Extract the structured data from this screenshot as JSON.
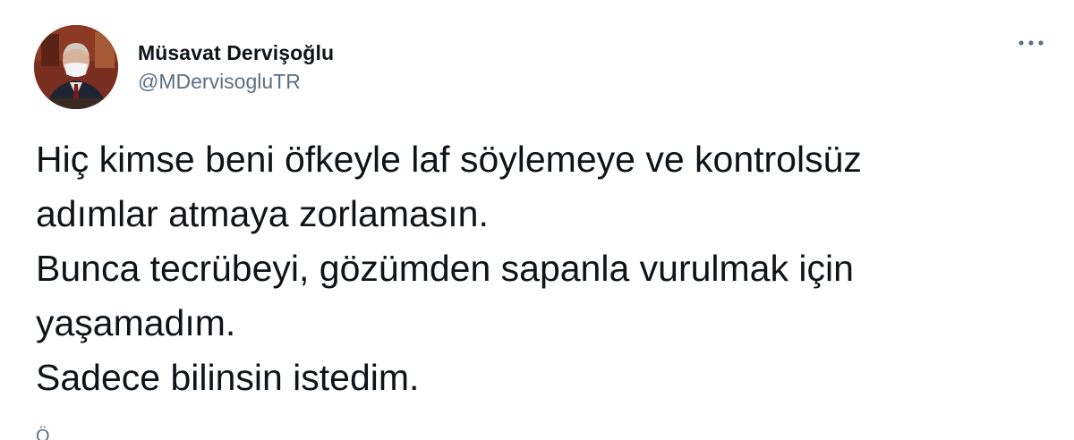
{
  "tweet": {
    "author": {
      "display_name": "Müsavat Dervişoğlu",
      "handle": "@MDervisogluTR",
      "avatar": "profile-photo"
    },
    "menu_icon": "more-horizontal-icon",
    "lines": [
      "Hiç kimse beni öfkeyle laf söylemeye ve kontrolsüz",
      "adımlar atmaya zorlamasın.",
      "Bunca tecrübeyi, gözümden sapanla vurulmak için",
      "yaşamadım.",
      "Sadece bilinsin istedim."
    ],
    "timestamp_partial": "Ö"
  },
  "colors": {
    "text_primary": "#0f1419",
    "text_secondary": "#5b7083",
    "background": "#ffffff"
  }
}
